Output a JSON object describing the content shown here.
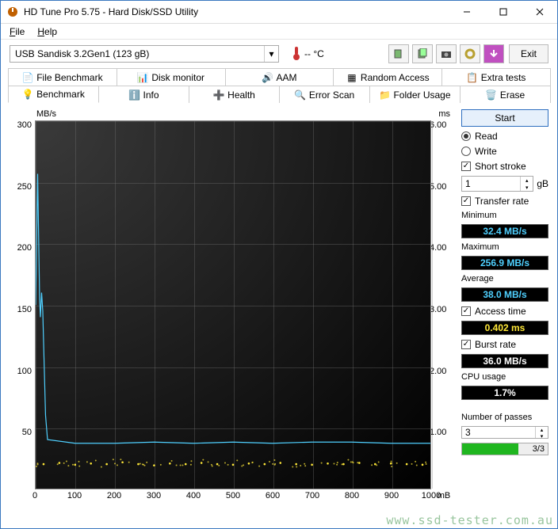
{
  "window": {
    "title": "HD Tune Pro 5.75 - Hard Disk/SSD Utility"
  },
  "menu": {
    "file": "File",
    "help": "Help"
  },
  "toolbar": {
    "device": "USB Sandisk 3.2Gen1 (123 gB)",
    "temp": "-- °C",
    "exit": "Exit"
  },
  "tabs_top": [
    "File Benchmark",
    "Disk monitor",
    "AAM",
    "Random Access",
    "Extra tests"
  ],
  "tabs_bot": [
    "Benchmark",
    "Info",
    "Health",
    "Error Scan",
    "Folder Usage",
    "Erase"
  ],
  "side": {
    "start": "Start",
    "read": "Read",
    "write": "Write",
    "short_stroke": "Short stroke",
    "short_val": "1",
    "short_unit": "gB",
    "transfer_rate": "Transfer rate",
    "min_label": "Minimum",
    "min_val": "32.4 MB/s",
    "max_label": "Maximum",
    "max_val": "256.9 MB/s",
    "avg_label": "Average",
    "avg_val": "38.0 MB/s",
    "access_label": "Access time",
    "access_val": "0.402 ms",
    "burst_label": "Burst rate",
    "burst_val": "36.0 MB/s",
    "cpu_label": "CPU usage",
    "cpu_val": "1.7%",
    "passes_label": "Number of passes",
    "passes_val": "3",
    "passes_done": "3/3"
  },
  "chart_data": {
    "type": "line",
    "title": "",
    "xlabel": "mB",
    "ylabel_left": "MB/s",
    "ylabel_right": "ms",
    "xlim": [
      0,
      1000
    ],
    "ylim_left": [
      0,
      300
    ],
    "ylim_right": [
      0,
      6.0
    ],
    "xticks": [
      0,
      100,
      200,
      300,
      400,
      500,
      600,
      700,
      800,
      900,
      1000
    ],
    "yticks_left": [
      50,
      100,
      150,
      200,
      250,
      300
    ],
    "yticks_right": [
      1.0,
      2.0,
      3.0,
      4.0,
      5.0,
      6.0
    ],
    "series": [
      {
        "name": "Transfer rate (MB/s)",
        "axis": "left",
        "color": "#4fd0ff",
        "x": [
          0,
          5,
          10,
          12,
          15,
          18,
          20,
          25,
          30,
          100,
          200,
          300,
          400,
          500,
          600,
          700,
          800,
          900,
          1000
        ],
        "values": [
          150,
          257,
          155,
          140,
          160,
          145,
          120,
          60,
          40,
          37,
          37,
          38,
          37,
          38,
          37,
          38,
          38,
          37,
          37
        ]
      },
      {
        "name": "Access time (ms)",
        "axis": "right",
        "color": "#ffe838",
        "style": "scatter",
        "x": [
          20,
          60,
          100,
          140,
          180,
          220,
          260,
          300,
          340,
          380,
          420,
          460,
          500,
          540,
          580,
          620,
          660,
          700,
          740,
          780,
          820,
          860,
          900,
          940,
          980
        ],
        "values": [
          0.4,
          0.42,
          0.39,
          0.41,
          0.4,
          0.43,
          0.4,
          0.38,
          0.41,
          0.4,
          0.42,
          0.4,
          0.39,
          0.41,
          0.4,
          0.42,
          0.4,
          0.39,
          0.41,
          0.4,
          0.42,
          0.4,
          0.41,
          0.4,
          0.39
        ]
      }
    ]
  },
  "watermark": "www.ssd-tester.com.au"
}
